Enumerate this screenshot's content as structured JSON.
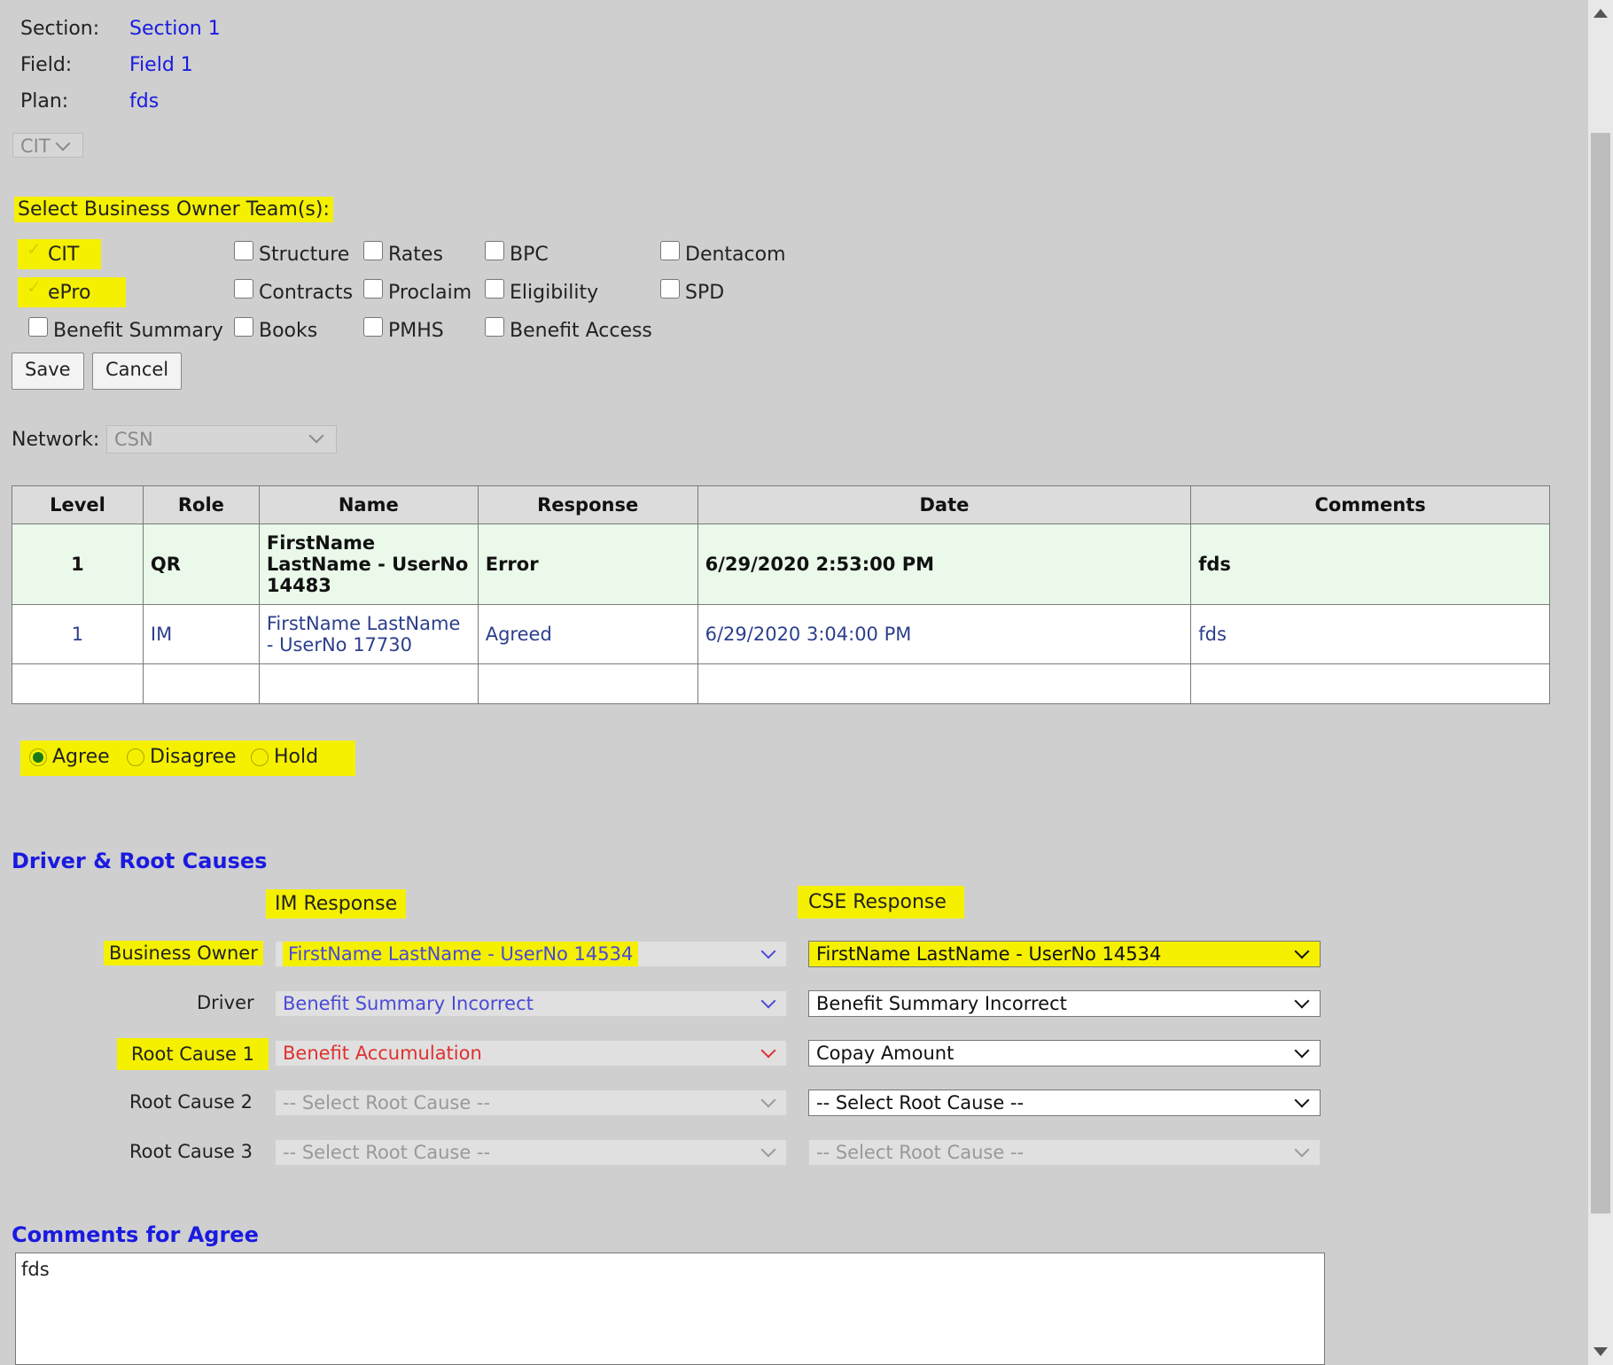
{
  "info": {
    "section_label": "Section:",
    "section_value": "Section 1",
    "field_label": "Field:",
    "field_value": "Field 1",
    "plan_label": "Plan:",
    "plan_value": "fds"
  },
  "team_select": {
    "value": "CIT"
  },
  "owner_teams": {
    "label": "Select Business Owner Team(s):",
    "items": [
      {
        "label": "CIT",
        "checked": true
      },
      {
        "label": "ePro",
        "checked": true
      },
      {
        "label": "Benefit Summary",
        "checked": false
      },
      {
        "label": "Structure",
        "checked": false
      },
      {
        "label": "Contracts",
        "checked": false
      },
      {
        "label": "Books",
        "checked": false
      },
      {
        "label": "Rates",
        "checked": false
      },
      {
        "label": "Proclaim",
        "checked": false
      },
      {
        "label": "PMHS",
        "checked": false
      },
      {
        "label": "BPC",
        "checked": false
      },
      {
        "label": "Eligibility",
        "checked": false
      },
      {
        "label": "Benefit Access",
        "checked": false
      },
      {
        "label": "Dentacom",
        "checked": false
      },
      {
        "label": "SPD",
        "checked": false
      }
    ]
  },
  "buttons": {
    "save": "Save",
    "cancel": "Cancel"
  },
  "network": {
    "label": "Network:",
    "value": "CSN"
  },
  "table": {
    "headers": [
      "Level",
      "Role",
      "Name",
      "Response",
      "Date",
      "Comments"
    ],
    "rows": [
      [
        "1",
        "QR",
        "FirstName LastName - UserNo 14483",
        "Error",
        "6/29/2020 2:53:00 PM",
        "fds"
      ],
      [
        "1",
        "IM",
        "FirstName LastName - UserNo 17730",
        "Agreed",
        "6/29/2020 3:04:00 PM",
        "fds"
      ]
    ]
  },
  "decision": {
    "options": [
      "Agree",
      "Disagree",
      "Hold"
    ],
    "selected": "Agree"
  },
  "driver_section": {
    "title": "Driver & Root Causes",
    "im_header": "IM Response",
    "cse_header": "CSE Response",
    "rows": [
      {
        "label": "Business Owner",
        "im": "FirstName LastName - UserNo 14534",
        "cse": "FirstName LastName - UserNo 14534"
      },
      {
        "label": "Driver",
        "im": "Benefit Summary Incorrect",
        "cse": "Benefit Summary Incorrect"
      },
      {
        "label": "Root Cause 1",
        "im": "Benefit Accumulation",
        "cse": "Copay Amount"
      },
      {
        "label": "Root Cause 2",
        "im": "-- Select Root Cause --",
        "cse": "-- Select Root Cause --"
      },
      {
        "label": "Root Cause 3",
        "im": "-- Select Root Cause --",
        "cse": "-- Select Root Cause --"
      }
    ]
  },
  "comments": {
    "title": "Comments for Agree",
    "value": "fds"
  },
  "colors": {
    "highlight": "#f4f000",
    "link_blue": "#1a1ae0",
    "error_red": "#e03030",
    "im_blue": "#4a4ad8",
    "table_highlight_row": "#eaf9ea"
  }
}
